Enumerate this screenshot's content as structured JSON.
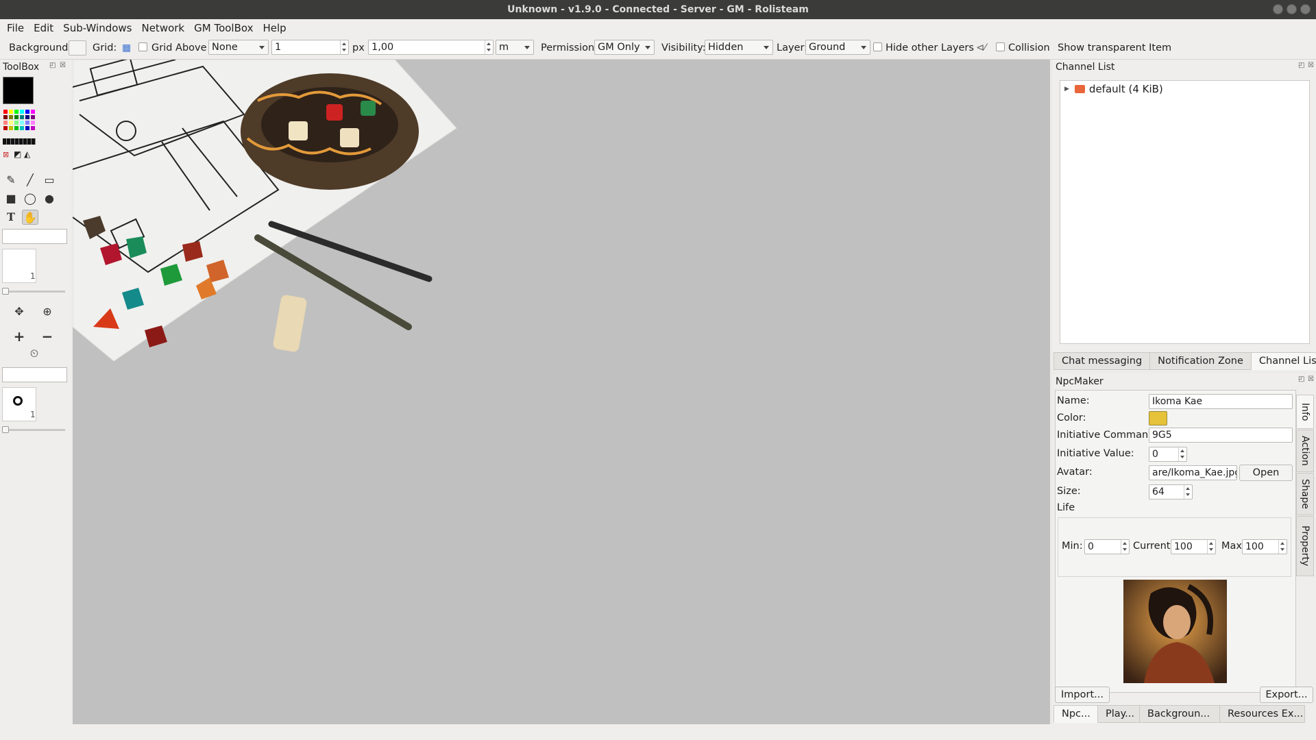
{
  "window": {
    "title": "Unknown - v1.9.0 - Connected - Server - GM - Rolisteam"
  },
  "menu": [
    "File",
    "Edit",
    "Sub-Windows",
    "Network",
    "GM ToolBox",
    "Help"
  ],
  "toolbar": {
    "background_label": "Background:",
    "grid_label": "Grid:",
    "grid_above_label": "Grid Above",
    "grid_pattern_value": "None",
    "grid_size_value": "1",
    "px_label": "px :",
    "scale_value": "1,00",
    "unit_value": "m",
    "permission_label": "Permission:",
    "permission_value": "GM Only",
    "visibility_label": "Visibility:",
    "visibility_value": "Hidden",
    "layer_label": "Layer:",
    "layer_value": "Ground",
    "hide_layers_label": "Hide other Layers",
    "collision_label": "Collision",
    "show_transparent_label": "Show transparent Item"
  },
  "toolbox": {
    "title": "ToolBox",
    "pen_size_value": "1",
    "npc_size_value": "1",
    "colors": {
      "current": "#000000",
      "palette": [
        "#ff0000",
        "#ffff00",
        "#00ff00",
        "#00ffff",
        "#0000ff",
        "#ff00ff",
        "#800000",
        "#808000",
        "#008000",
        "#008080",
        "#000080",
        "#800080",
        "#ff8080",
        "#ffff80",
        "#80ff80",
        "#80ffff",
        "#8080ff",
        "#ff80ff",
        "#c00000",
        "#c0c000",
        "#00c000",
        "#00c0c0",
        "#0000c0",
        "#c000c0"
      ]
    }
  },
  "channel_list": {
    "title": "Channel List",
    "items": [
      {
        "label": "default (4 KiB)"
      }
    ],
    "tabs": [
      "Chat messaging",
      "Notification Zone",
      "Channel List"
    ],
    "active_tab": "Channel List"
  },
  "npc_maker": {
    "title": "NpcMaker",
    "name_label": "Name:",
    "name_value": "Ikoma Kae",
    "color_label": "Color:",
    "color_value": "#e5c23a",
    "initiative_command_label": "Initiative Command",
    "initiative_command_value": "9G5",
    "initiative_value_label": "Initiative Value:",
    "initiative_value": "0",
    "avatar_label": "Avatar:",
    "avatar_value": "are/Ikoma_Kae.jpg",
    "open_label": "Open",
    "size_label": "Size:",
    "size_value": "64",
    "life_label": "Life",
    "min_label": "Min:",
    "min_value": "0",
    "current_label": "Current",
    "current_value": "100",
    "max_label": "Max",
    "max_value": "100",
    "side_tabs": [
      "Info",
      "Action",
      "Shape",
      "Property"
    ],
    "import_label": "Import...",
    "export_label": "Export..."
  },
  "bottom_tabs": [
    "Npc...",
    "Play...",
    "Backgroun...",
    "Resources Ex..."
  ]
}
